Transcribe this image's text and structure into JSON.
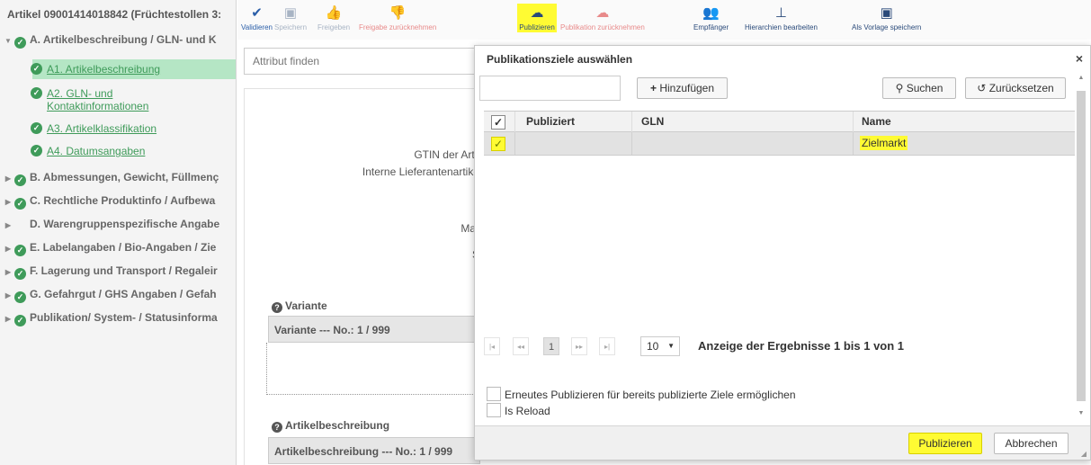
{
  "tree": {
    "title": "Artikel 09001414018842 (Früchtestollen 3:",
    "section_a": "A. Artikelbeschreibung / GLN- und K",
    "subitems": [
      "A1. Artikelbeschreibung",
      "A2. GLN- und",
      "Kontaktinformationen",
      "A3. Artikelklassifikation",
      "A4. Datumsangaben"
    ],
    "sections": [
      "B. Abmessungen, Gewicht, Füllmenç",
      "C. Rechtliche Produktinfo / Aufbewa",
      "D. Warengruppenspezifische Angabe",
      "E. Labelangaben / Bio-Angaben / Zie",
      "F. Lagerung und Transport / Regaleir",
      "G. Gefahrgut / GHS Angaben / Gefah",
      "Publikation/ System- / Statusinforma"
    ]
  },
  "toolbar": {
    "validieren": "Validieren",
    "speichern": "Speichern",
    "freigeben": "Freigeben",
    "freigabe_zurueck": "Freigabe zurücknehmen",
    "publizieren": "Publizieren",
    "publikation_zurueck": "Publikation zurücknehmen",
    "empfaenger": "Empfänger",
    "hierarchien": "Hierarchien bearbeiten",
    "vorlage": "Als Vorlage speichern"
  },
  "form": {
    "find_placeholder": "Attribut finden",
    "labels": {
      "gtin": "GTIN der Artil",
      "interne": "Interne Lieferantenartike",
      "mar": "Mar",
      "s": "S"
    },
    "variante_title": "Variante",
    "variante_box": "Variante --- No.: 1 / 999",
    "artikel_title": "Artikelbeschreibung",
    "artikel_box": "Artikelbeschreibung --- No.: 1 / 999"
  },
  "dialog": {
    "title": "Publikationsziele auswählen",
    "close": "×",
    "add_label": "Hinzufügen",
    "search_label": "Suchen",
    "reset_label": "Zurücksetzen",
    "columns": {
      "check": "✓",
      "publiziert": "Publiziert",
      "gln": "GLN",
      "name": "Name"
    },
    "row": {
      "check": "✓",
      "publiziert": "",
      "gln": "",
      "name": "Zielmarkt"
    },
    "pager": {
      "first": "|◂",
      "prev": "◂◂",
      "current": "1",
      "next": "▸▸",
      "last": "▸|",
      "page_size": "10",
      "info": "Anzeige der Ergebnisse 1 bis 1 von 1"
    },
    "option_republish": "Erneutes Publizieren für bereits publizierte Ziele ermöglichen",
    "option_reload": "Is Reload",
    "publish_label": "Publizieren",
    "cancel_label": "Abbrechen"
  },
  "colors": {
    "highlight": "#fffb33",
    "green": "#3f9b5a",
    "selected_tree": "#b5e6c5",
    "disabled_red": "#e88a8a"
  }
}
